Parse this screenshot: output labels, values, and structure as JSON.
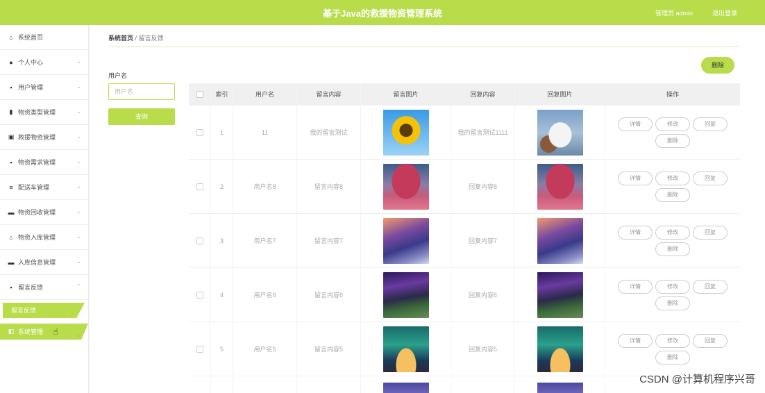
{
  "header": {
    "title": "基于Java的救援物资管理系统",
    "links": [
      "管理员 admin",
      "退出登录"
    ]
  },
  "sidebar": {
    "items": [
      {
        "label": "系统首页",
        "icon": "home-icon",
        "chevron": false
      },
      {
        "label": "个人中心",
        "icon": "person-icon",
        "chevron": true
      },
      {
        "label": "用户管理",
        "icon": "grid-icon",
        "chevron": true
      },
      {
        "label": "物资类型管理",
        "icon": "bar-chart-icon",
        "chevron": true
      },
      {
        "label": "救援物资管理",
        "icon": "box-icon",
        "chevron": true
      },
      {
        "label": "物资需求管理",
        "icon": "grid-icon",
        "chevron": true
      },
      {
        "label": "配送车管理",
        "icon": "list-icon",
        "chevron": true
      },
      {
        "label": "物资回收管理",
        "icon": "book-icon",
        "chevron": true
      },
      {
        "label": "物资入库管理",
        "icon": "warehouse-icon",
        "chevron": true
      },
      {
        "label": "入库信息管理",
        "icon": "book-icon",
        "chevron": true
      },
      {
        "label": "留言反馈",
        "icon": "grid-icon",
        "chevron": true,
        "expanded": true
      }
    ],
    "submenu": {
      "label": "留言反馈"
    },
    "bottom": {
      "label": "系统管理",
      "icon": "system-icon"
    }
  },
  "breadcrumb": {
    "home": "系统首页",
    "sep": "/",
    "current": "留言反馈"
  },
  "search": {
    "label": "用户名",
    "placeholder": "用户名",
    "button": "查询"
  },
  "actions": {
    "delete": "删除"
  },
  "table": {
    "headers": [
      "",
      "索引",
      "用户名",
      "留言内容",
      "留言图片",
      "回复内容",
      "回复图片",
      "操作"
    ],
    "rows": [
      {
        "index": "1",
        "username": "11",
        "message": "我的留言测试",
        "img1": "sunflower",
        "reply": "我的留言测试1111",
        "img2": "mask"
      },
      {
        "index": "2",
        "username": "用户名8",
        "message": "留言内容8",
        "img1": "tree",
        "reply": "回复内容8",
        "img2": "tree"
      },
      {
        "index": "3",
        "username": "用户名7",
        "message": "留言内容7",
        "img1": "snow",
        "reply": "回复内容7",
        "img2": "snow"
      },
      {
        "index": "4",
        "username": "用户名6",
        "message": "留言内容6",
        "img1": "cliff",
        "reply": "回复内容6",
        "img2": "cliff"
      },
      {
        "index": "5",
        "username": "用户名5",
        "message": "留言内容5",
        "img1": "tent",
        "reply": "回复内容5",
        "img2": "tent"
      }
    ],
    "row_buttons": [
      "详情",
      "修改",
      "回复",
      "删除"
    ]
  },
  "watermark": "CSDN @计算机程序兴哥",
  "colors": {
    "accent": "#b9dc4a"
  }
}
